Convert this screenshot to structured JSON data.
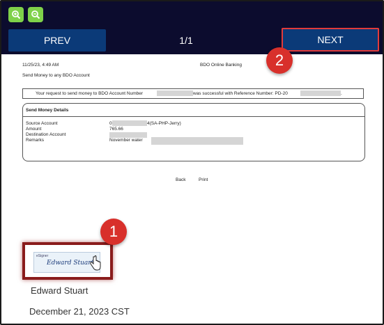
{
  "toolbar": {
    "zoom_in_icon": "zoom-in-icon",
    "zoom_out_icon": "zoom-out-icon",
    "prev_label": "PREV",
    "page_indicator": "1/1",
    "next_label": "NEXT"
  },
  "callouts": {
    "one": "1",
    "two": "2"
  },
  "colors": {
    "topbar": "#0c0c2e",
    "nav_button": "#0b3a78",
    "zoom_button": "#7fd14a",
    "callout": "#d8302b",
    "highlight": "#e23b3b"
  },
  "receipt": {
    "timestamp": "11/25/23, 4:49 AM",
    "site": "BDO Online Banking",
    "heading": "Send Money to any BDO Account",
    "message_prefix": "Your request to send money to BDO Account Number",
    "message_middle": "was successful with Reference Number: PD-20",
    "message_suffix": ".",
    "details_title": "Send Money Details",
    "labels": {
      "source": "Source Account",
      "amount": "Amount",
      "destination": "Destination Account",
      "remarks": "Remarks"
    },
    "values": {
      "source_prefix": "0",
      "source_suffix": "4(SA-PHP-Jerry)",
      "amount": "765.66",
      "remarks_prefix": "November water"
    },
    "links": {
      "back": "Back",
      "print": "Print"
    }
  },
  "signature": {
    "brand": "eSigner",
    "script_name": "Edward Stuart",
    "signer_name": "Edward Stuart",
    "date": "December 21, 2023 CST"
  }
}
